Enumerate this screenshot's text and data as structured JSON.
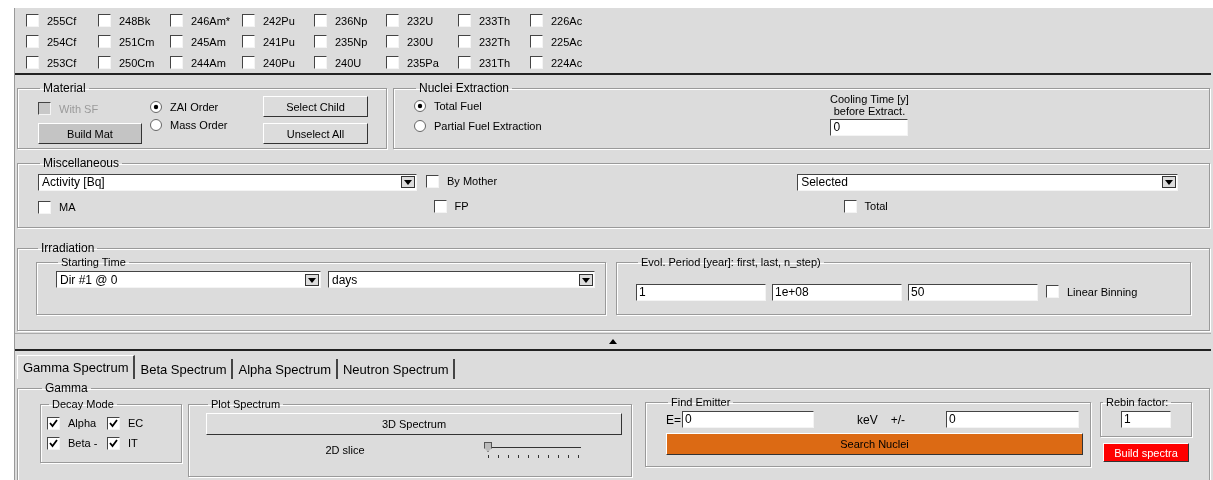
{
  "nuclides": [
    [
      {
        "label": "255Cf",
        "checked": false
      },
      {
        "label": "248Bk",
        "checked": false
      },
      {
        "label": "246Am*",
        "checked": false
      },
      {
        "label": "242Pu",
        "checked": false
      },
      {
        "label": "236Np",
        "checked": false
      },
      {
        "label": "232U",
        "checked": false
      },
      {
        "label": "233Th",
        "checked": false
      },
      {
        "label": "226Ac",
        "checked": false
      }
    ],
    [
      {
        "label": "254Cf",
        "checked": false
      },
      {
        "label": "251Cm",
        "checked": false
      },
      {
        "label": "245Am",
        "checked": false
      },
      {
        "label": "241Pu",
        "checked": false
      },
      {
        "label": "235Np",
        "checked": false
      },
      {
        "label": "230U",
        "checked": false
      },
      {
        "label": "232Th",
        "checked": false
      },
      {
        "label": "225Ac",
        "checked": false
      }
    ],
    [
      {
        "label": "253Cf",
        "checked": false
      },
      {
        "label": "250Cm",
        "checked": false
      },
      {
        "label": "244Am",
        "checked": false
      },
      {
        "label": "240Pu",
        "checked": false
      },
      {
        "label": "240U",
        "checked": false
      },
      {
        "label": "235Pa",
        "checked": false
      },
      {
        "label": "231Th",
        "checked": false
      },
      {
        "label": "224Ac",
        "checked": false
      }
    ]
  ],
  "material": {
    "title": "Material",
    "with_sf": {
      "label": "With SF",
      "checked": false,
      "disabled": true
    },
    "build_button": "Build Mat",
    "order": [
      {
        "label": "ZAI Order",
        "selected": true
      },
      {
        "label": "Mass Order",
        "selected": false
      }
    ],
    "buttons": [
      "Select Child",
      "Unselect All"
    ]
  },
  "nuclei_extraction": {
    "title": "Nuclei Extraction",
    "options": [
      {
        "label": "Total Fuel",
        "selected": true
      },
      {
        "label": "Partial Fuel Extraction",
        "selected": false
      }
    ],
    "cooling_label": [
      "Cooling Time [y]",
      "before Extract."
    ],
    "cooling_value": "0"
  },
  "miscellaneous": {
    "title": "Miscellaneous",
    "quantity": "Activity [Bq]",
    "by_mother": {
      "label": "By Mother",
      "checked": false
    },
    "selection": "Selected",
    "ma": {
      "label": "MA",
      "checked": false
    },
    "fp": {
      "label": "FP",
      "checked": false
    },
    "total": {
      "label": "Total",
      "checked": false
    }
  },
  "irradiation": {
    "title": "Irradiation",
    "starting_time": {
      "title": "Starting Time",
      "dir": "Dir #1 @ 0",
      "unit": "days"
    },
    "evol_period": {
      "title": "Evol. Period [year]: first, last, n_step)",
      "first": "1",
      "last": "1e+08",
      "n_step": "50",
      "linear_binning": {
        "label": "Linear Binning",
        "checked": false
      }
    }
  },
  "tabs": [
    {
      "label": "Gamma Spectrum",
      "selected": true
    },
    {
      "label": "Beta Spectrum",
      "selected": false
    },
    {
      "label": "Alpha Spectrum",
      "selected": false
    },
    {
      "label": "Neutron Spectrum",
      "selected": false
    }
  ],
  "gamma": {
    "title": "Gamma",
    "decay_mode": {
      "title": "Decay Mode",
      "modes": [
        {
          "label": "Alpha",
          "checked": true
        },
        {
          "label": "EC",
          "checked": true
        },
        {
          "label": "Beta -",
          "checked": true
        },
        {
          "label": "IT",
          "checked": true
        }
      ]
    },
    "plot_spectrum": {
      "title": "Plot Spectrum",
      "button": "3D Spectrum",
      "slice_label": "2D slice",
      "level": 0
    },
    "find_emitter": {
      "title": "Find Emitter",
      "e_label": "E=",
      "e_value": "0",
      "unit": "keV",
      "pm": "+/-",
      "tolerance": "0",
      "button": "Search Nuclei"
    },
    "rebin": {
      "title": "Rebin factor:",
      "value": "1"
    },
    "build_button": "Build spectra"
  }
}
